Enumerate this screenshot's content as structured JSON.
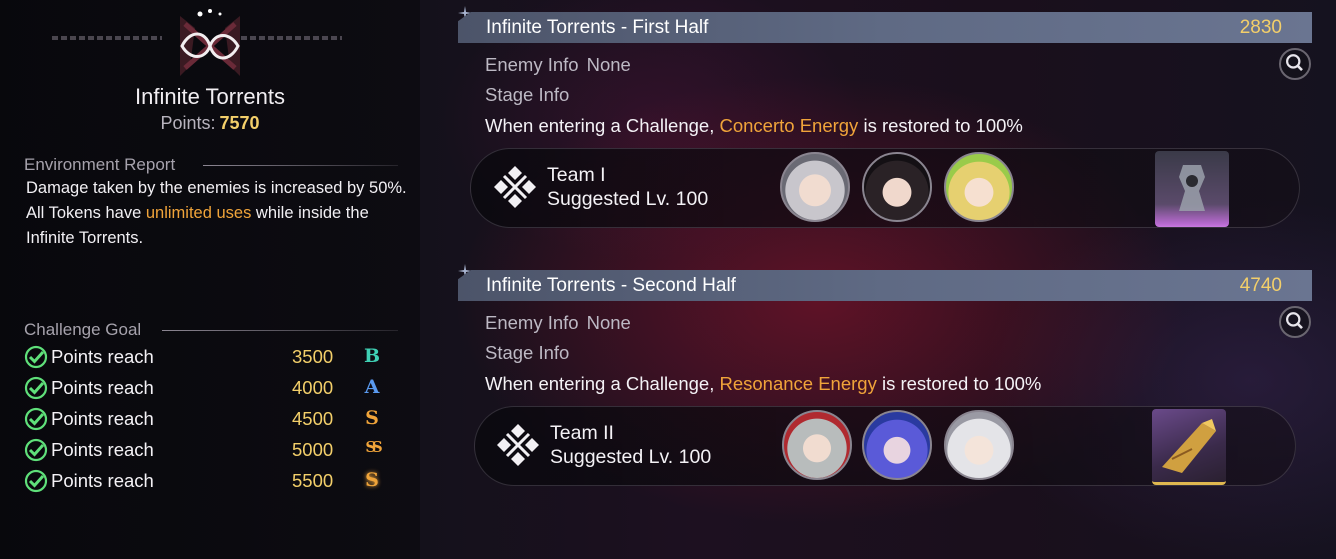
{
  "left": {
    "mode_title": "Infinite Torrents",
    "points_label": "Points:",
    "points_value": "7570",
    "environment_report_heading": "Environment Report",
    "environment_lines": {
      "line1": "Damage taken by the enemies is increased by 50%.",
      "line2_pre": "All Tokens have ",
      "line2_hl": "unlimited uses",
      "line2_post": " while inside the Infinite Torrents."
    },
    "challenge_goal_heading": "Challenge Goal",
    "goals": [
      {
        "label": "Points reach",
        "value": "3500",
        "rank": "B",
        "rank_color": "#3fd0b4",
        "completed": true
      },
      {
        "label": "Points reach",
        "value": "4000",
        "rank": "A",
        "rank_color": "#5a9af0",
        "completed": true
      },
      {
        "label": "Points reach",
        "value": "4500",
        "rank": "S",
        "rank_color": "#f0a43a",
        "completed": true
      },
      {
        "label": "Points reach",
        "value": "5000",
        "rank": "SS",
        "rank_color": "#f0a43a",
        "completed": true
      },
      {
        "label": "Points reach",
        "value": "5500",
        "rank": "S",
        "rank_color": "#f0a43a",
        "completed": true
      }
    ]
  },
  "stages": [
    {
      "title": "Infinite Torrents - First Half",
      "points": "2830",
      "enemy_info_label": "Enemy Info",
      "enemy_info_value": "None",
      "stage_info_label": "Stage Info",
      "desc_pre": "When entering a Challenge, ",
      "desc_hl": "Concerto Energy",
      "desc_post": " is restored to 100%",
      "team_name": "Team I",
      "suggested_level": "Suggested Lv. 100"
    },
    {
      "title": "Infinite Torrents - Second Half",
      "points": "4740",
      "enemy_info_label": "Enemy Info",
      "enemy_info_value": "None",
      "stage_info_label": "Stage Info",
      "desc_pre": "When entering a Challenge, ",
      "desc_hl": "Resonance Energy",
      "desc_post": " is restored to 100%",
      "team_name": "Team II",
      "suggested_level": "Suggested Lv. 100"
    }
  ],
  "colors": {
    "accent_gold": "#f3cf6a",
    "highlight_orange": "#f0a43a",
    "check_green": "#5fe07a"
  }
}
